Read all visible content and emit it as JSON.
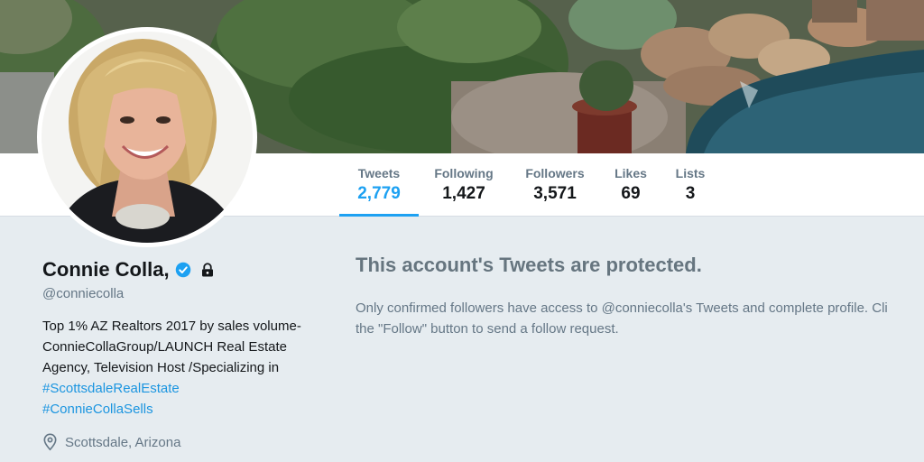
{
  "profile": {
    "name": "Connie Colla,",
    "handle": "@conniecolla",
    "bio_text": "Top 1% AZ Realtors 2017 by sales volume- ConnieCollaGroup/LAUNCH Real Estate Agency, Television Host /Specializing in ",
    "bio_hashtag_1": "#ScottsdaleRealEstate",
    "bio_hashtag_2": "#ConnieCollaSells",
    "location": "Scottsdale, Arizona",
    "verified_icon": "verified-badge-icon",
    "lock_icon": "lock-icon",
    "location_icon": "map-pin-icon"
  },
  "nav": {
    "stats": [
      {
        "label": "Tweets",
        "value": "2,779",
        "active": true
      },
      {
        "label": "Following",
        "value": "1,427"
      },
      {
        "label": "Followers",
        "value": "3,571"
      },
      {
        "label": "Likes",
        "value": "69"
      },
      {
        "label": "Lists",
        "value": "3"
      }
    ]
  },
  "protected": {
    "title": "This account's Tweets are protected.",
    "body_line_1": "Only confirmed followers have access to @conniecolla's Tweets and complete profile. Cli",
    "body_line_2": "the \"Follow\" button to send a follow request."
  },
  "colors": {
    "accent": "#1da1f2",
    "link": "#1b95e0",
    "background": "#e6ecf0"
  }
}
